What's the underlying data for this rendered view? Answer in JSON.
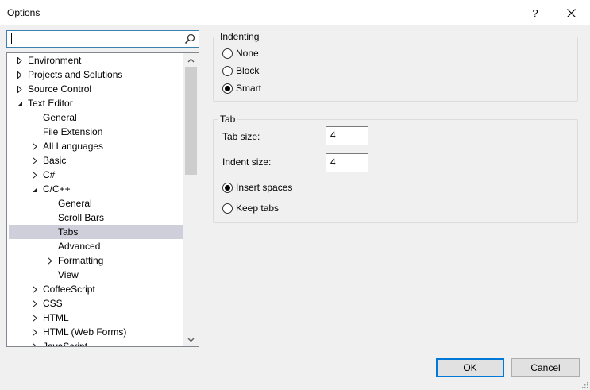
{
  "window": {
    "title": "Options",
    "help_glyph": "?",
    "close_glyph": "✕"
  },
  "search": {
    "value": "",
    "placeholder": ""
  },
  "tree": {
    "items": [
      {
        "label": "Environment",
        "depth": 0,
        "expander": "collapsed",
        "selected": false
      },
      {
        "label": "Projects and Solutions",
        "depth": 0,
        "expander": "collapsed",
        "selected": false
      },
      {
        "label": "Source Control",
        "depth": 0,
        "expander": "collapsed",
        "selected": false
      },
      {
        "label": "Text Editor",
        "depth": 0,
        "expander": "expanded",
        "selected": false
      },
      {
        "label": "General",
        "depth": 1,
        "expander": "none",
        "selected": false
      },
      {
        "label": "File Extension",
        "depth": 1,
        "expander": "none",
        "selected": false
      },
      {
        "label": "All Languages",
        "depth": 1,
        "expander": "collapsed",
        "selected": false
      },
      {
        "label": "Basic",
        "depth": 1,
        "expander": "collapsed",
        "selected": false
      },
      {
        "label": "C#",
        "depth": 1,
        "expander": "collapsed",
        "selected": false
      },
      {
        "label": "C/C++",
        "depth": 1,
        "expander": "expanded",
        "selected": false
      },
      {
        "label": "General",
        "depth": 2,
        "expander": "none",
        "selected": false
      },
      {
        "label": "Scroll Bars",
        "depth": 2,
        "expander": "none",
        "selected": false
      },
      {
        "label": "Tabs",
        "depth": 2,
        "expander": "none",
        "selected": true
      },
      {
        "label": "Advanced",
        "depth": 2,
        "expander": "none",
        "selected": false
      },
      {
        "label": "Formatting",
        "depth": 2,
        "expander": "collapsed",
        "selected": false
      },
      {
        "label": "View",
        "depth": 2,
        "expander": "none",
        "selected": false
      },
      {
        "label": "CoffeeScript",
        "depth": 1,
        "expander": "collapsed",
        "selected": false
      },
      {
        "label": "CSS",
        "depth": 1,
        "expander": "collapsed",
        "selected": false
      },
      {
        "label": "HTML",
        "depth": 1,
        "expander": "collapsed",
        "selected": false
      },
      {
        "label": "HTML (Web Forms)",
        "depth": 1,
        "expander": "collapsed",
        "selected": false
      },
      {
        "label": "JavaScript",
        "depth": 1,
        "expander": "collapsed",
        "selected": false
      }
    ]
  },
  "indenting": {
    "title": "Indenting",
    "options": [
      {
        "label": "None",
        "checked": false
      },
      {
        "label": "Block",
        "checked": false
      },
      {
        "label": "Smart",
        "checked": true
      }
    ]
  },
  "tab": {
    "title": "Tab",
    "tab_size_label": "Tab size:",
    "tab_size_value": "4",
    "indent_size_label": "Indent size:",
    "indent_size_value": "4",
    "options": [
      {
        "label": "Insert spaces",
        "checked": true
      },
      {
        "label": "Keep tabs",
        "checked": false
      }
    ]
  },
  "buttons": {
    "ok_label": "OK",
    "cancel_label": "Cancel"
  },
  "colors": {
    "selection": "#cfcfdc",
    "focus_border": "#0078d7"
  }
}
